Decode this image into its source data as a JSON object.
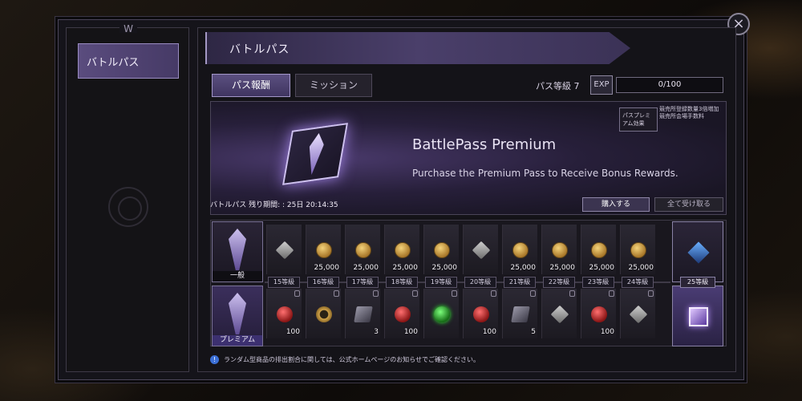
{
  "sidebar": {
    "items": [
      {
        "label": "バトルパス"
      }
    ]
  },
  "header": {
    "title": "バトルパス",
    "close_icon": "×"
  },
  "tabs": [
    {
      "label": "パス報酬"
    },
    {
      "label": "ミッション"
    }
  ],
  "level": {
    "label": "パス等級 7",
    "exp_icon": "EXP",
    "exp_text": "0/100",
    "exp_progress": 0
  },
  "banner": {
    "title": "BattlePass Premium",
    "subtitle": "Purchase the Premium Pass to Receive Bonus Rewards.",
    "effect_tag": "パスプレミアム効果",
    "effect_desc": "競売所登録数量3倍増加 競売所会場手数料",
    "remaining": "バトルパス 残り期間: : 25日 20:14:35",
    "buy_label": "購入する",
    "claim_label": "全て受け取る"
  },
  "rows": {
    "free_label": "一般",
    "premium_label": "プレミアム"
  },
  "levels": [
    "15等級",
    "16等級",
    "17等級",
    "18等級",
    "19等級",
    "20等級",
    "21等級",
    "22等級",
    "23等級",
    "24等級"
  ],
  "end_level": "25等級",
  "free_rewards": [
    {
      "icon": "box",
      "qty": ""
    },
    {
      "icon": "coin",
      "qty": "25,000"
    },
    {
      "icon": "coin",
      "qty": "25,000"
    },
    {
      "icon": "coin",
      "qty": "25,000"
    },
    {
      "icon": "coin",
      "qty": "25,000"
    },
    {
      "icon": "box",
      "qty": ""
    },
    {
      "icon": "coin",
      "qty": "25,000"
    },
    {
      "icon": "coin",
      "qty": "25,000"
    },
    {
      "icon": "coin",
      "qty": "25,000"
    },
    {
      "icon": "coin",
      "qty": "25,000"
    }
  ],
  "premium_rewards": [
    {
      "icon": "ruby",
      "qty": "100"
    },
    {
      "icon": "ring",
      "qty": ""
    },
    {
      "icon": "ticket",
      "qty": "3"
    },
    {
      "icon": "ruby",
      "qty": "100"
    },
    {
      "icon": "emerald",
      "qty": ""
    },
    {
      "icon": "ruby",
      "qty": "100"
    },
    {
      "icon": "ticket",
      "qty": "5"
    },
    {
      "icon": "box",
      "qty": ""
    },
    {
      "icon": "ruby",
      "qty": "100"
    },
    {
      "icon": "box",
      "qty": ""
    }
  ],
  "notice": {
    "icon": "!",
    "text": "ランダム型商品の排出割合に関しては、公式ホームページのお知らせでご確認ください。"
  }
}
